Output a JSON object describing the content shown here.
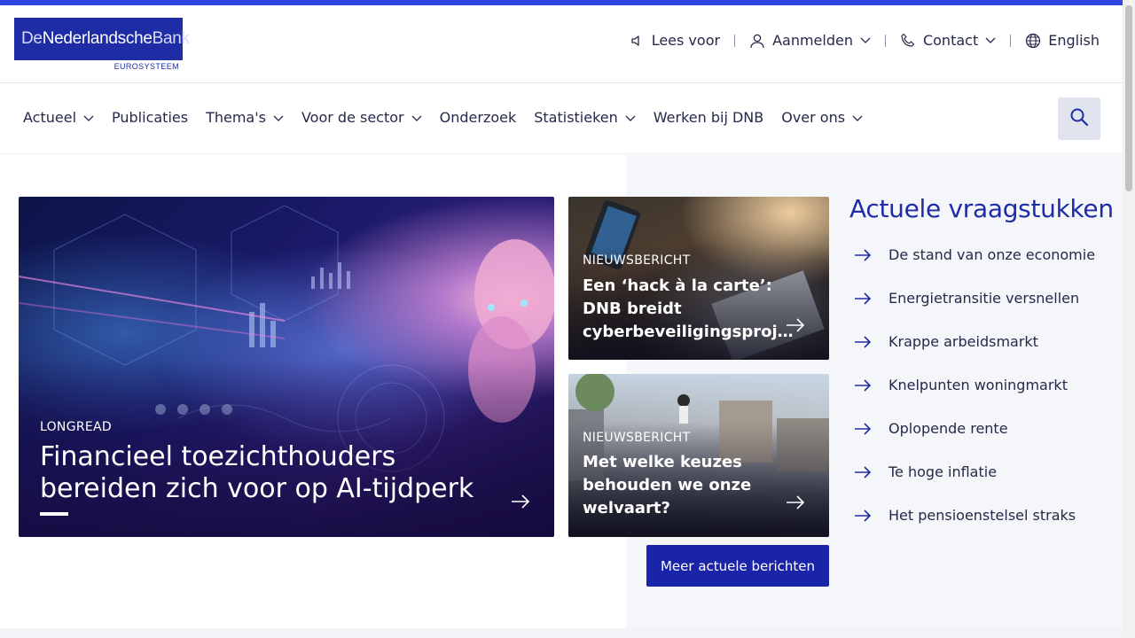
{
  "logo": {
    "name_part1": "De",
    "name_part2": "Nederlandsche",
    "name_part3": "Bank",
    "subtitle": "EUROSYSTEEM"
  },
  "utility_nav": {
    "read_aloud": "Lees voor",
    "login": "Aanmelden",
    "contact": "Contact",
    "language": "English"
  },
  "main_nav": {
    "items": [
      {
        "label": "Actueel",
        "has_dropdown": true
      },
      {
        "label": "Publicaties",
        "has_dropdown": false
      },
      {
        "label": "Thema's",
        "has_dropdown": true
      },
      {
        "label": "Voor de sector",
        "has_dropdown": true
      },
      {
        "label": "Onderzoek",
        "has_dropdown": false
      },
      {
        "label": "Statistieken",
        "has_dropdown": true
      },
      {
        "label": "Werken bij DNB",
        "has_dropdown": false
      },
      {
        "label": "Over ons",
        "has_dropdown": true
      }
    ],
    "search_icon": "search-icon"
  },
  "featured": {
    "type": "LONGREAD",
    "title": "Financieel toezichthouders bereiden zich voor op AI-tijdperk"
  },
  "news": [
    {
      "type": "NIEUWSBERICHT",
      "title": "Een ‘hack à la carte’: DNB breidt cyberbeveiligingsproj…"
    },
    {
      "type": "NIEUWSBERICHT",
      "title": "Met welke keuzes behouden we onze welvaart?"
    }
  ],
  "more_button": "Meer actuele berichten",
  "issues": {
    "title": "Actuele vraagstukken",
    "items": [
      "De stand van onze economie",
      "Energietransitie versnellen",
      "Krappe arbeidsmarkt",
      "Knelpunten woningmarkt",
      "Oplopende rente",
      "Te hoge inflatie",
      "Het pensioenstelsel straks"
    ]
  },
  "colors": {
    "brand": "#1e2da5",
    "accent_bar": "#2f44e0",
    "button": "#1a24a8"
  }
}
